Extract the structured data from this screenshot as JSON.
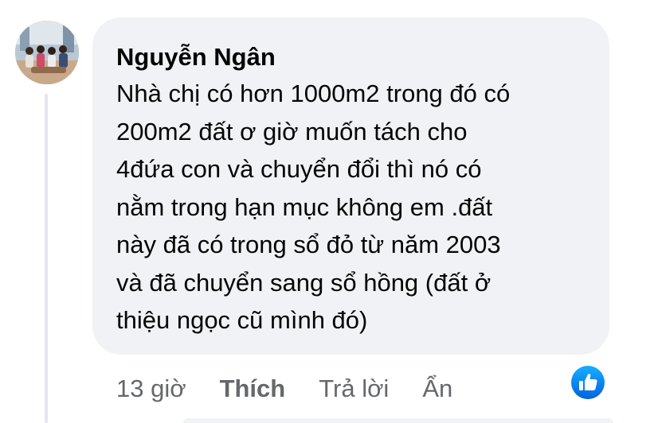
{
  "comment": {
    "author": "Nguyễn Ngân",
    "text": "Nhà chị có hơn 1000m2 trong đó có\n200m2 đất ơ giờ muốn tách cho\n4đứa con và chuyển đổi thì nó có\nnằm trong hạn mục không em .đất\nnày đã có trong sổ đỏ từ năm 2003\nvà đã chuyển sang sổ hồng (đất ở\nthiệu ngọc cũ mình đó)",
    "timestamp": "13 giờ",
    "actions": {
      "like": "Thích",
      "reply": "Trả lời",
      "hide": "Ẩn"
    },
    "reaction_icon": "thumbs-up-icon"
  },
  "colors": {
    "bubble_bg": "#f0f2f5",
    "text": "#050505",
    "meta_text": "#65676b",
    "like_blue": "#1877f2"
  }
}
